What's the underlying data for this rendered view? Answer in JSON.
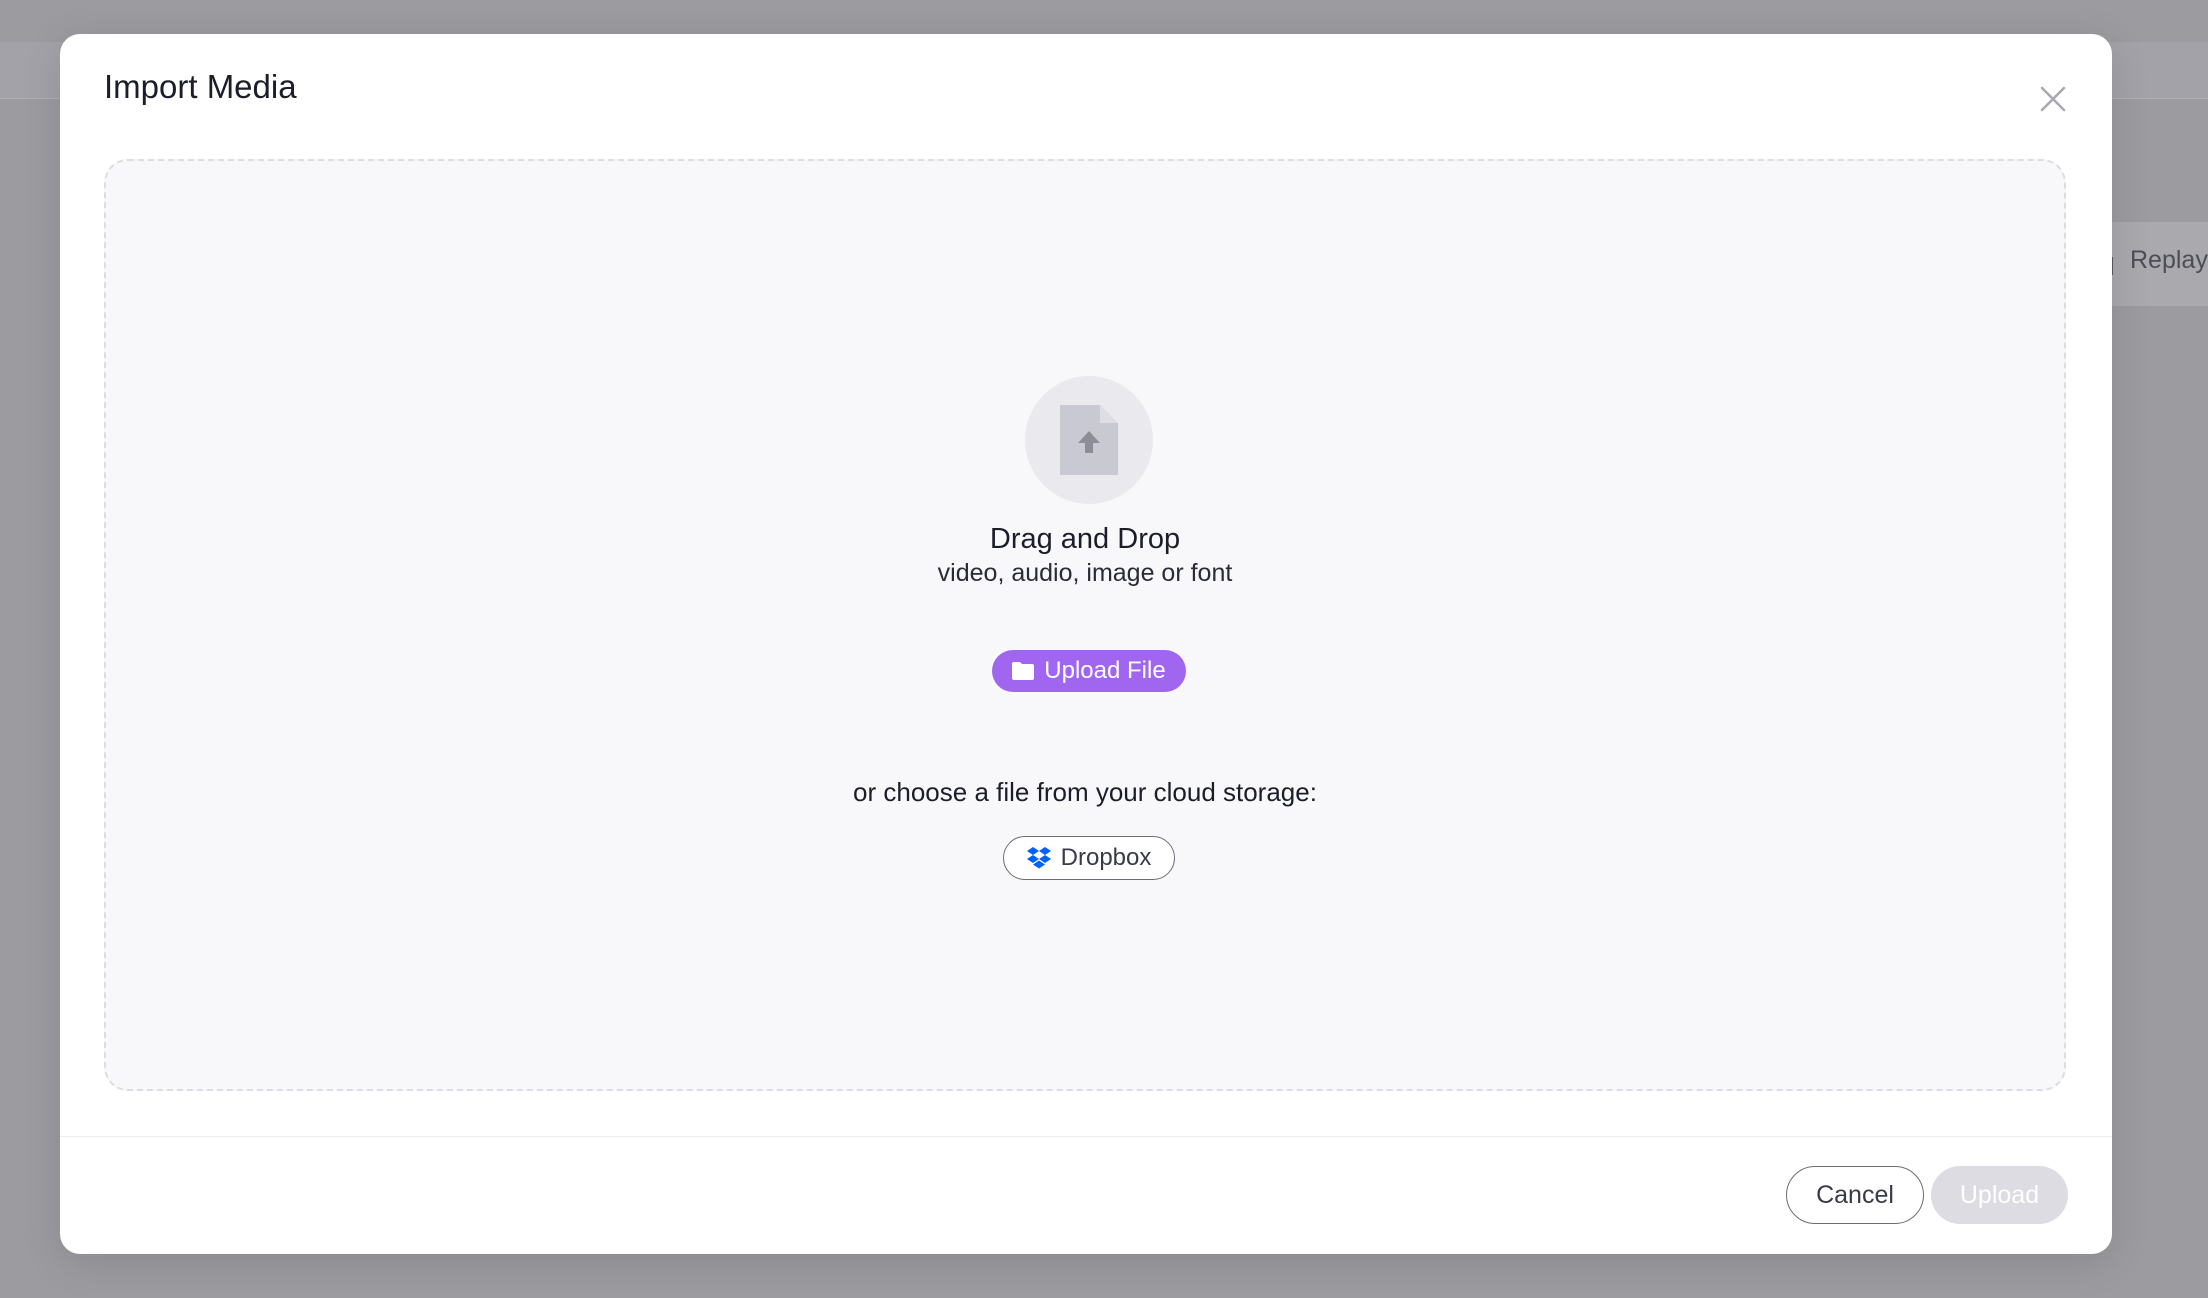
{
  "background": {
    "side_button_label": "Replay"
  },
  "modal": {
    "title": "Import Media",
    "close_icon": "close-icon"
  },
  "dropzone": {
    "icon": "file-upload-icon",
    "title": "Drag and Drop",
    "subtitle": "video, audio, image or font",
    "upload_file_label": "Upload File",
    "upload_file_icon": "folder-icon",
    "cloud_text": "or choose a file from your cloud storage:",
    "dropbox_label": "Dropbox",
    "dropbox_icon": "dropbox-icon"
  },
  "footer": {
    "cancel_label": "Cancel",
    "upload_label": "Upload",
    "upload_disabled": true
  },
  "colors": {
    "overlay": "#9b9ba0",
    "accent": "#a066f0",
    "dropbox_blue": "#0061fe",
    "disabled": "#dcdce2"
  }
}
